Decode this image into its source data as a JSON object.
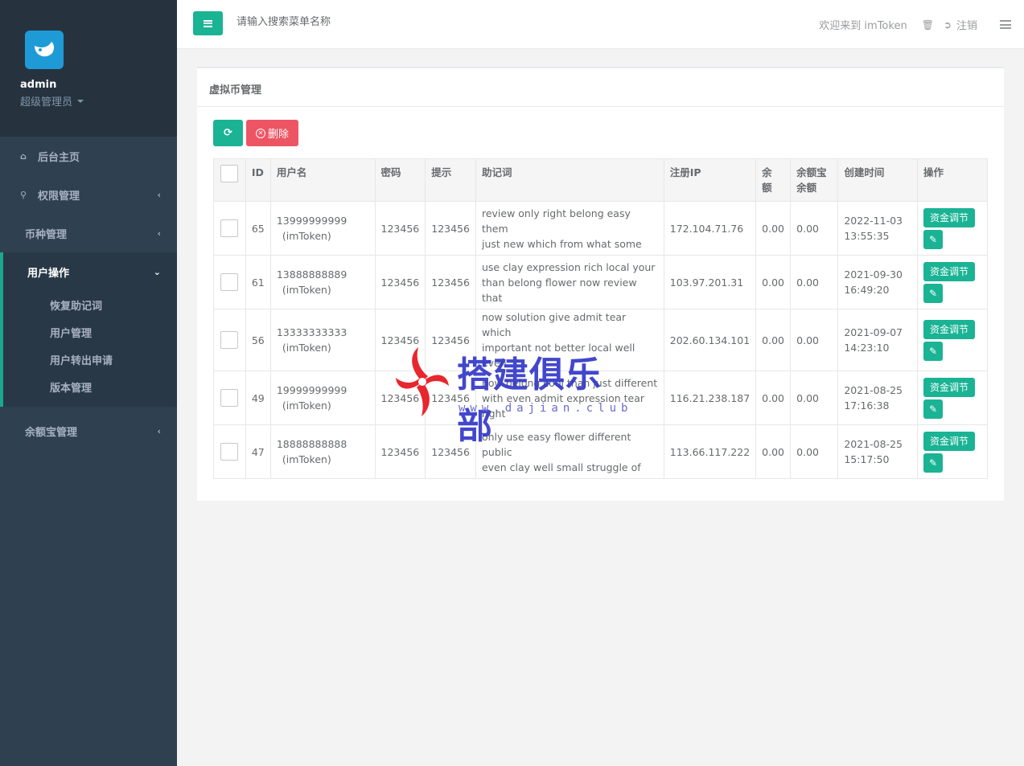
{
  "profile": {
    "name": "admin",
    "role": "超级管理员"
  },
  "nav": {
    "home": "后台主页",
    "permissions": "权限管理",
    "currency": "币种管理",
    "user_ops": "用户操作",
    "sub_items": [
      "恢复助记词",
      "用户管理",
      "用户转出申请",
      "版本管理"
    ],
    "balance": "余额宝管理"
  },
  "topbar": {
    "search_placeholder": "请输入搜索菜单名称",
    "welcome": "欢迎来到 imToken",
    "logout": "注销"
  },
  "panel": {
    "title": "虚拟币管理",
    "delete_label": "删除"
  },
  "table": {
    "headers": {
      "id": "ID",
      "username": "用户名",
      "password": "密码",
      "hint": "提示",
      "mnemonic": "助记词",
      "ip": "注册IP",
      "balance_1": "余",
      "balance_2": "额",
      "yeb_1": "余额宝",
      "yeb_2": "余额",
      "created": "创建时间",
      "actions": "操作"
    },
    "fund_label": "资金调节",
    "rows": [
      {
        "id": "65",
        "user": "13999999999",
        "user_sub": "(imToken)",
        "password": "123456",
        "hint": "123456",
        "mn1": "review only right belong easy them",
        "mn2": "just new which from what some",
        "ip": "172.104.71.76",
        "balance": "0.00",
        "yeb": "0.00",
        "date": "2022-11-03",
        "time": "13:55:35"
      },
      {
        "id": "61",
        "user": "13888888889",
        "user_sub": "(imToken)",
        "password": "123456",
        "hint": "123456",
        "mn1": "use clay expression rich local your",
        "mn2": "than belong flower now review that",
        "ip": "103.97.201.31",
        "balance": "0.00",
        "yeb": "0.00",
        "date": "2021-09-30",
        "time": "16:49:20"
      },
      {
        "id": "56",
        "user": "13333333333",
        "user_sub": "(imToken)",
        "password": "123456",
        "hint": "123456",
        "mn1": "now solution give admit tear which",
        "mn2": "important not better local well even",
        "ip": "202.60.134.101",
        "balance": "0.00",
        "yeb": "0.00",
        "date": "2021-09-07",
        "time": "14:23:10"
      },
      {
        "id": "49",
        "user": "19999999999",
        "user_sub": "(imToken)",
        "password": "123456",
        "hint": "123456",
        "mn1": "now belong cool than just different",
        "mn2": "with even admit expression tear right",
        "ip": "116.21.238.187",
        "balance": "0.00",
        "yeb": "0.00",
        "date": "2021-08-25",
        "time": "17:16:38"
      },
      {
        "id": "47",
        "user": "18888888888",
        "user_sub": "(imToken)",
        "password": "123456",
        "hint": "123456",
        "mn1": "only use easy flower different public",
        "mn2": "even clay well small struggle of",
        "ip": "113.66.117.222",
        "balance": "0.00",
        "yeb": "0.00",
        "date": "2021-08-25",
        "time": "15:17:50"
      }
    ]
  },
  "watermark": {
    "text": "搭建俱乐部",
    "url": "www.dajian.club"
  }
}
